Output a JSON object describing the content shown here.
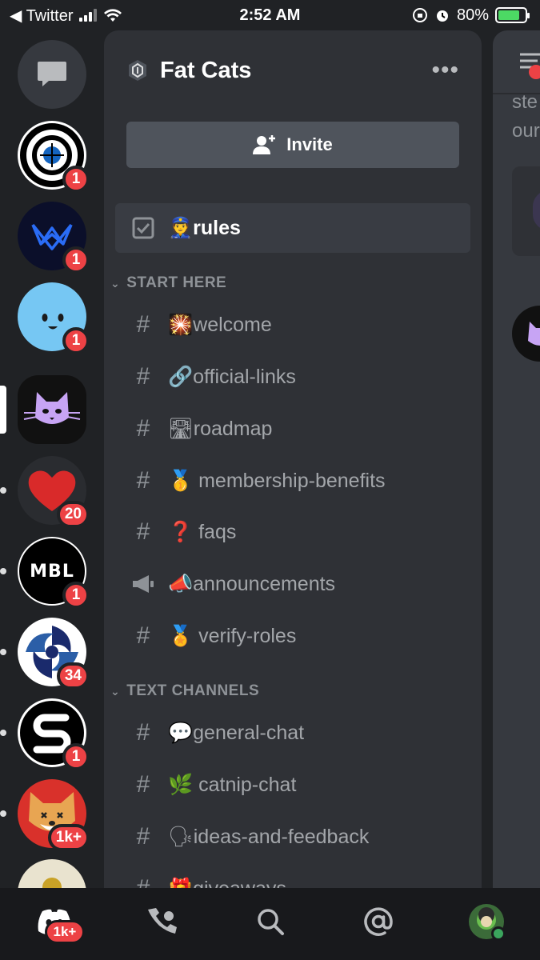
{
  "status_bar": {
    "carrier": "◀ Twitter",
    "time": "2:52 AM",
    "battery_percent": "80%",
    "battery_level": 0.8
  },
  "servers": [
    {
      "name": "direct-messages",
      "badge": ""
    },
    {
      "name": "target-server",
      "badge": "1"
    },
    {
      "name": "crown-server",
      "badge": "1"
    },
    {
      "name": "smile-server",
      "badge": "1"
    },
    {
      "name": "fat-cats-server",
      "badge": ""
    },
    {
      "name": "heart-server",
      "badge": "20"
    },
    {
      "name": "mbl-server",
      "badge": "1",
      "logo_text": "MBL"
    },
    {
      "name": "swirl-server",
      "badge": "34"
    },
    {
      "name": "s-logo-server",
      "badge": "1"
    },
    {
      "name": "shiba-server",
      "badge": "1k+"
    },
    {
      "name": "gold-server",
      "badge": ""
    }
  ],
  "guild": {
    "name": "Fat Cats",
    "invite_label": "Invite"
  },
  "channels": {
    "rules": {
      "emoji": "👮",
      "name": "rules"
    },
    "start_here": {
      "title": "START HERE",
      "items": [
        {
          "emoji": "🎇",
          "name": "welcome"
        },
        {
          "emoji": "🔗",
          "name": "official-links"
        },
        {
          "emoji": "🛣",
          "name": "roadmap"
        },
        {
          "emoji": "🥇",
          "name": "membership-benefits"
        },
        {
          "emoji": "❓",
          "name": "faqs"
        },
        {
          "emoji": "📣",
          "name": "announcements"
        },
        {
          "emoji": "🏅",
          "name": "verify-roles"
        }
      ]
    },
    "text_channels": {
      "title": "TEXT CHANNELS",
      "items": [
        {
          "emoji": "💬",
          "name": "general-chat"
        },
        {
          "emoji": "🌿",
          "name": "catnip-chat"
        },
        {
          "emoji": "🗣",
          "name": "ideas-and-feedback"
        },
        {
          "emoji": "🎁",
          "name": "giveaways"
        }
      ]
    }
  },
  "peek": {
    "line1": "ste",
    "line2": "our"
  },
  "bottom_nav": {
    "home_badge": "1k+"
  },
  "colors": {
    "accent_red": "#ed4245",
    "panel": "#2f3136",
    "rail": "#202225",
    "invite": "#4f545c"
  }
}
